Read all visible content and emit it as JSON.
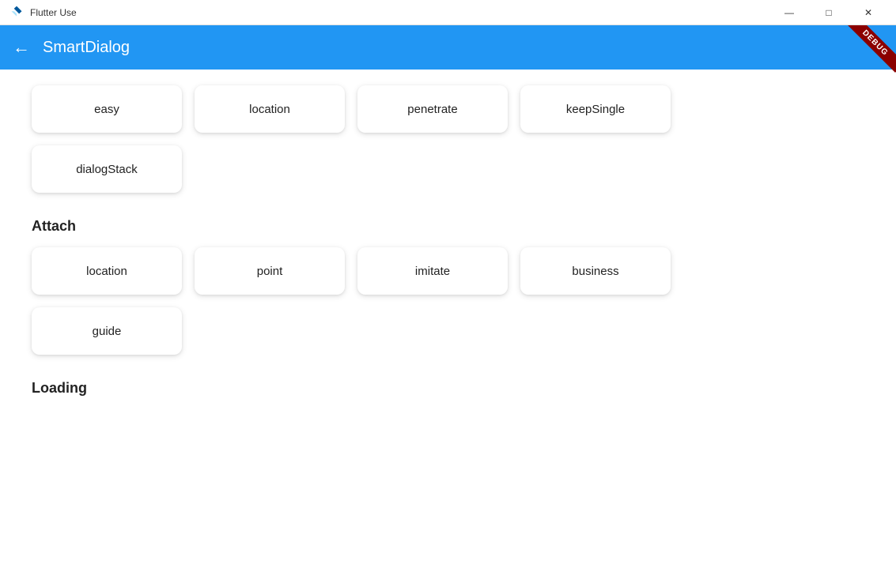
{
  "titleBar": {
    "appName": "Flutter Use",
    "minimize": "—",
    "maximize": "□",
    "close": "✕"
  },
  "appBar": {
    "title": "SmartDialog",
    "backIcon": "←",
    "debugLabel": "DEBUG"
  },
  "sections": [
    {
      "id": "top",
      "label": null,
      "buttons": [
        "easy",
        "location",
        "penetrate",
        "keepSingle"
      ]
    },
    {
      "id": "top-row2",
      "label": null,
      "buttons": [
        "dialogStack"
      ]
    },
    {
      "id": "attach",
      "label": "Attach",
      "buttons": [
        "location",
        "point",
        "imitate",
        "business"
      ]
    },
    {
      "id": "attach-row2",
      "label": null,
      "buttons": [
        "guide"
      ]
    },
    {
      "id": "loading",
      "label": "Loading",
      "buttons": []
    }
  ]
}
